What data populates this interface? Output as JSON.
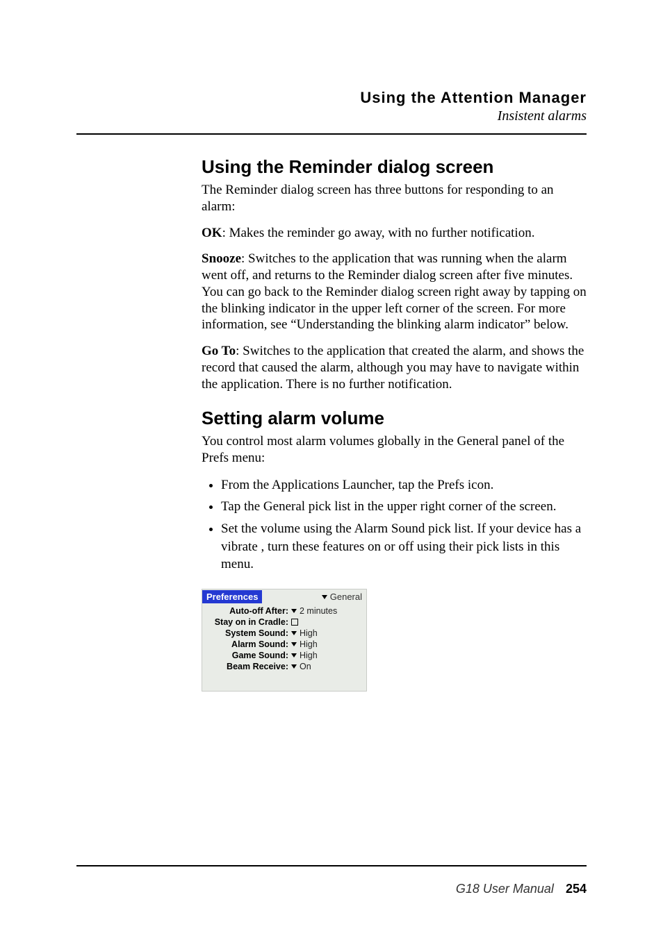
{
  "header": {
    "chapter": "Using the Attention Manager",
    "subtitle": "Insistent alarms"
  },
  "section1": {
    "title": "Using the Reminder dialog screen",
    "intro": "The Reminder dialog screen has three buttons for responding to an alarm:",
    "ok_bold": "OK",
    "ok_rest": ": Makes the reminder go away, with no further notification.",
    "snooze_bold": "Snooze",
    "snooze_rest": ": Switches to the application that was running when the alarm went off, and returns to the Reminder dialog screen after five minutes. You can go back to the Reminder dialog screen right away by tapping on the blinking indicator in the upper left corner of the screen. For more information, see “Understanding the blinking alarm indicator” below.",
    "goto_bold": "Go To",
    "goto_rest": ": Switches to the application that created the alarm, and shows the record that caused the alarm, although you may have to navigate within the application. There is no further notification."
  },
  "section2": {
    "title": "Setting alarm volume",
    "intro": "You control most alarm volumes globally in the General panel of the Prefs menu:",
    "bullets": [
      "From the Applications Launcher, tap the Prefs icon.",
      "Tap the General pick list in the upper right corner of the screen.",
      "Set the volume using the Alarm Sound pick list. If your device has a vibrate , turn these features on or off using their pick lists in this menu."
    ]
  },
  "prefs": {
    "title": "Preferences",
    "category": "General",
    "rows": {
      "auto_off_label": "Auto-off After:",
      "auto_off_value": "2 minutes",
      "stay_on_label": "Stay on in Cradle:",
      "system_sound_label": "System Sound:",
      "system_sound_value": "High",
      "alarm_sound_label": "Alarm Sound:",
      "alarm_sound_value": "High",
      "game_sound_label": "Game Sound:",
      "game_sound_value": "High",
      "beam_receive_label": "Beam Receive:",
      "beam_receive_value": "On"
    }
  },
  "footer": {
    "manual": "G18 User Manual",
    "page": "254"
  }
}
